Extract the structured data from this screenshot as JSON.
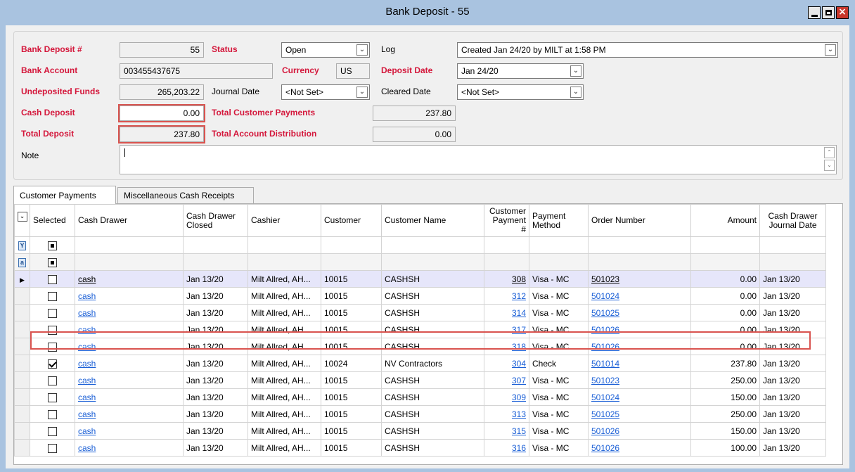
{
  "window": {
    "title": "Bank Deposit - 55"
  },
  "header": {
    "bank_deposit_label": "Bank Deposit #",
    "bank_deposit_value": "55",
    "status_label": "Status",
    "status_value": "Open",
    "log_label": "Log",
    "log_value": "Created Jan 24/20 by MILT at 1:58 PM",
    "bank_account_label": "Bank Account",
    "bank_account_value": "003455437675",
    "currency_label": "Currency",
    "currency_value": "US",
    "deposit_date_label": "Deposit Date",
    "deposit_date_value": "Jan 24/20",
    "undeposited_label": "Undeposited Funds",
    "undeposited_value": "265,203.22",
    "journal_date_label": "Journal Date",
    "journal_date_value": "<Not Set>",
    "cleared_date_label": "Cleared Date",
    "cleared_date_value": "<Not Set>",
    "cash_deposit_label": "Cash Deposit",
    "cash_deposit_value": "0.00",
    "total_cust_payments_label": "Total Customer Payments",
    "total_cust_payments_value": "237.80",
    "total_deposit_label": "Total Deposit",
    "total_deposit_value": "237.80",
    "total_acct_dist_label": "Total Account Distribution",
    "total_acct_dist_value": "0.00",
    "note_label": "Note",
    "note_value": ""
  },
  "tabs": [
    {
      "label": "Customer Payments"
    },
    {
      "label": "Miscellaneous Cash Receipts"
    }
  ],
  "columns": {
    "selected": "Selected",
    "cash_drawer": "Cash Drawer",
    "closed": "Cash Drawer Closed",
    "cashier": "Cashier",
    "customer": "Customer",
    "customer_name": "Customer Name",
    "payment_no": "Customer Payment #",
    "method": "Payment Method",
    "order": "Order Number",
    "amount": "Amount",
    "journal_date": "Cash Drawer Journal Date"
  },
  "rows": [
    {
      "drawer": "cash",
      "closed": "Jan 13/20",
      "cashier": "Milt Allred, AH...",
      "customer": "10015",
      "name": "CASHSH",
      "pay": "308",
      "method": "Visa - MC",
      "order": "501023",
      "amount": "0.00",
      "jdate": "Jan 13/20",
      "selected": false
    },
    {
      "drawer": "cash",
      "closed": "Jan 13/20",
      "cashier": "Milt Allred, AH...",
      "customer": "10015",
      "name": "CASHSH",
      "pay": "312",
      "method": "Visa - MC",
      "order": "501024",
      "amount": "0.00",
      "jdate": "Jan 13/20",
      "selected": false
    },
    {
      "drawer": "cash",
      "closed": "Jan 13/20",
      "cashier": "Milt Allred, AH...",
      "customer": "10015",
      "name": "CASHSH",
      "pay": "314",
      "method": "Visa - MC",
      "order": "501025",
      "amount": "0.00",
      "jdate": "Jan 13/20",
      "selected": false
    },
    {
      "drawer": "cash",
      "closed": "Jan 13/20",
      "cashier": "Milt Allred, AH...",
      "customer": "10015",
      "name": "CASHSH",
      "pay": "317",
      "method": "Visa - MC",
      "order": "501026",
      "amount": "0.00",
      "jdate": "Jan 13/20",
      "selected": false
    },
    {
      "drawer": "cash",
      "closed": "Jan 13/20",
      "cashier": "Milt Allred, AH...",
      "customer": "10015",
      "name": "CASHSH",
      "pay": "318",
      "method": "Visa - MC",
      "order": "501026",
      "amount": "0.00",
      "jdate": "Jan 13/20",
      "selected": false
    },
    {
      "drawer": "cash",
      "closed": "Jan 13/20",
      "cashier": "Milt Allred, AH...",
      "customer": "10024",
      "name": "NV Contractors",
      "pay": "304",
      "method": "Check",
      "order": "501014",
      "amount": "237.80",
      "jdate": "Jan 13/20",
      "selected": true
    },
    {
      "drawer": "cash",
      "closed": "Jan 13/20",
      "cashier": "Milt Allred, AH...",
      "customer": "10015",
      "name": "CASHSH",
      "pay": "307",
      "method": "Visa - MC",
      "order": "501023",
      "amount": "250.00",
      "jdate": "Jan 13/20",
      "selected": false
    },
    {
      "drawer": "cash",
      "closed": "Jan 13/20",
      "cashier": "Milt Allred, AH...",
      "customer": "10015",
      "name": "CASHSH",
      "pay": "309",
      "method": "Visa - MC",
      "order": "501024",
      "amount": "150.00",
      "jdate": "Jan 13/20",
      "selected": false
    },
    {
      "drawer": "cash",
      "closed": "Jan 13/20",
      "cashier": "Milt Allred, AH...",
      "customer": "10015",
      "name": "CASHSH",
      "pay": "313",
      "method": "Visa - MC",
      "order": "501025",
      "amount": "250.00",
      "jdate": "Jan 13/20",
      "selected": false
    },
    {
      "drawer": "cash",
      "closed": "Jan 13/20",
      "cashier": "Milt Allred, AH...",
      "customer": "10015",
      "name": "CASHSH",
      "pay": "315",
      "method": "Visa - MC",
      "order": "501026",
      "amount": "150.00",
      "jdate": "Jan 13/20",
      "selected": false
    },
    {
      "drawer": "cash",
      "closed": "Jan 13/20",
      "cashier": "Milt Allred, AH...",
      "customer": "10015",
      "name": "CASHSH",
      "pay": "316",
      "method": "Visa - MC",
      "order": "501026",
      "amount": "100.00",
      "jdate": "Jan 13/20",
      "selected": false
    }
  ],
  "colors": {
    "label_red": "#d4173b",
    "link_blue": "#1a5fd6",
    "highlight_red": "#d9534f",
    "current_row": "#e6e6fa"
  }
}
